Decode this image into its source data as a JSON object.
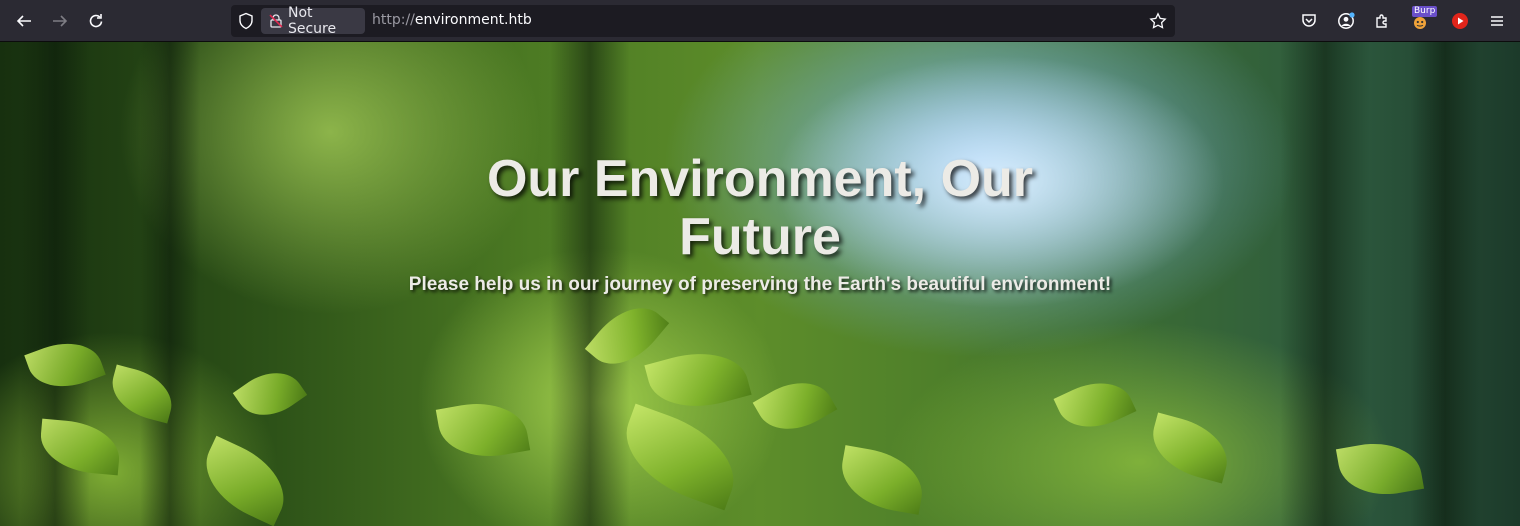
{
  "browser": {
    "address": {
      "security_label": "Not Secure",
      "url_scheme": "http://",
      "url_host": "environment.htb"
    },
    "extensions": {
      "burp_badge": "Burp"
    },
    "icons": [
      "back-arrow-icon",
      "forward-arrow-icon",
      "reload-icon",
      "shield-icon",
      "insecure-lock-icon",
      "bookmark-star-icon",
      "pocket-icon",
      "account-icon",
      "extensions-icon",
      "burp-icon",
      "youtube-icon",
      "menu-icon"
    ]
  },
  "page": {
    "title": "Our Environment, Our Future",
    "subtitle": "Please help us in our journey of preserving the Earth's beautiful environment!"
  },
  "colors": {
    "toolbar_bg": "#2b2a33",
    "urlbar_bg": "#1c1b22",
    "hero_text": "#ecebe6"
  }
}
